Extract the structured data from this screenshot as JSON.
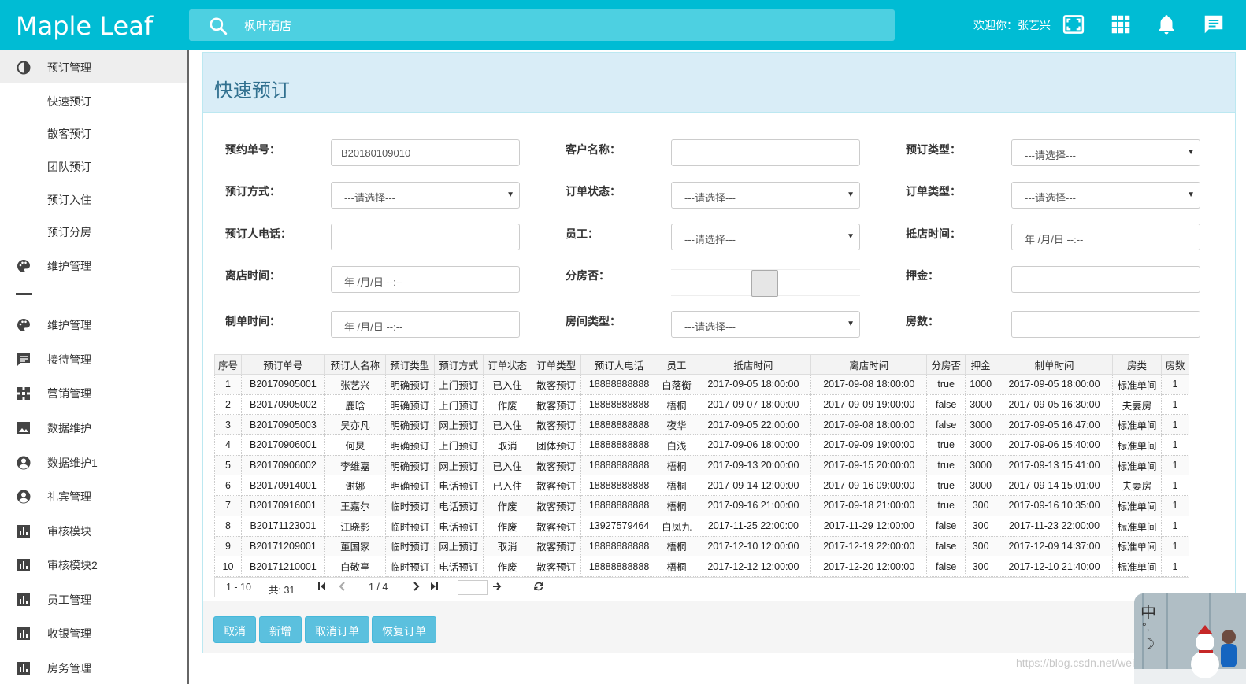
{
  "app": {
    "brand": "Maple Leaf",
    "welcome": "欢迎你：张艺兴"
  },
  "search": {
    "value": "枫叶酒店"
  },
  "icons": {
    "search": "search-icon",
    "fullscreen": "fullscreen-icon",
    "apps": "apps-grid-icon",
    "bell": "bell-icon",
    "message": "message-icon"
  },
  "colors": {
    "primary": "#00bcd4",
    "search_bg": "#4dd0e1",
    "btn": "#5bc0de",
    "panel_head": "#d9edf7",
    "title": "#31708f"
  },
  "sidebar": {
    "group1": {
      "label": "预订管理",
      "icon": "contrast-icon"
    },
    "subs": [
      "快速预订",
      "散客预订",
      "团队预订",
      "预订入住",
      "预订分房"
    ],
    "items": [
      {
        "label": "维护管理",
        "icon": "palette-icon"
      },
      {
        "label": "维护管理",
        "icon": "palette-icon"
      },
      {
        "label": "接待管理",
        "icon": "comment-icon"
      },
      {
        "label": "营销管理",
        "icon": "puzzle-icon"
      },
      {
        "label": "数据维护",
        "icon": "image-icon"
      },
      {
        "label": "数据维护1",
        "icon": "account-icon"
      },
      {
        "label": "礼宾管理",
        "icon": "account-icon"
      },
      {
        "label": "审核模块",
        "icon": "chart-bar-icon"
      },
      {
        "label": "审核模块2",
        "icon": "chart-bar-icon"
      },
      {
        "label": "员工管理",
        "icon": "chart-bar-icon"
      },
      {
        "label": "收银管理",
        "icon": "chart-bar-icon"
      },
      {
        "label": "房务管理",
        "icon": "chart-bar-icon"
      }
    ]
  },
  "panel": {
    "title": "快速预订"
  },
  "form": {
    "order_no": {
      "label": "预约单号：",
      "value": "B20180109010"
    },
    "customer": {
      "label": "客户名称：",
      "value": ""
    },
    "book_type": {
      "label": "预订类型：",
      "value": "---请选择---"
    },
    "book_way": {
      "label": "预订方式：",
      "value": "---请选择---"
    },
    "order_status": {
      "label": "订单状态：",
      "value": "---请选择---"
    },
    "order_type": {
      "label": "订单类型：",
      "value": "---请选择---"
    },
    "phone": {
      "label": "预订人电话：",
      "value": ""
    },
    "staff": {
      "label": "员工：",
      "value": "---请选择---"
    },
    "arrive": {
      "label": "抵店时间：",
      "value": "年 /月/日 --:--"
    },
    "leave": {
      "label": "离店时间：",
      "value": "年 /月/日 --:--"
    },
    "split": {
      "label": "分房否："
    },
    "deposit": {
      "label": "押金：",
      "value": ""
    },
    "made": {
      "label": "制单时间：",
      "value": "年 /月/日 --:--"
    },
    "room_type": {
      "label": "房间类型：",
      "value": "---请选择---"
    },
    "room_count": {
      "label": "房数：",
      "value": ""
    }
  },
  "table": {
    "headers": [
      "序号",
      "预订单号",
      "预订人名称",
      "预订类型",
      "预订方式",
      "订单状态",
      "订单类型",
      "预订人电话",
      "员工",
      "抵店时间",
      "离店时间",
      "分房否",
      "押金",
      "制单时间",
      "房类",
      "房数"
    ],
    "rows": [
      [
        "1",
        "B20170905001",
        "张艺兴",
        "明确预订",
        "上门预订",
        "已入住",
        "散客预订",
        "18888888888",
        "白落衡",
        "2017-09-05 18:00:00",
        "2017-09-08 18:00:00",
        "true",
        "1000",
        "2017-09-05 18:00:00",
        "标准单间",
        "1"
      ],
      [
        "2",
        "B20170905002",
        "鹿晗",
        "明确预订",
        "上门预订",
        "作废",
        "散客预订",
        "18888888888",
        "梧桐",
        "2017-09-07 18:00:00",
        "2017-09-09 19:00:00",
        "false",
        "3000",
        "2017-09-05 16:30:00",
        "夫妻房",
        "1"
      ],
      [
        "3",
        "B20170905003",
        "吴亦凡",
        "明确预订",
        "网上预订",
        "已入住",
        "散客预订",
        "18888888888",
        "夜华",
        "2017-09-05 22:00:00",
        "2017-09-08 18:00:00",
        "false",
        "3000",
        "2017-09-05 16:47:00",
        "标准单间",
        "1"
      ],
      [
        "4",
        "B20170906001",
        "何炅",
        "明确预订",
        "上门预订",
        "取消",
        "团体预订",
        "18888888888",
        "白浅",
        "2017-09-06 18:00:00",
        "2017-09-09 19:00:00",
        "true",
        "3000",
        "2017-09-06 15:40:00",
        "标准单间",
        "1"
      ],
      [
        "5",
        "B20170906002",
        "李维嘉",
        "明确预订",
        "网上预订",
        "已入住",
        "散客预订",
        "18888888888",
        "梧桐",
        "2017-09-13 20:00:00",
        "2017-09-15 20:00:00",
        "true",
        "3000",
        "2017-09-13 15:41:00",
        "标准单间",
        "1"
      ],
      [
        "6",
        "B20170914001",
        "谢娜",
        "明确预订",
        "电话预订",
        "已入住",
        "散客预订",
        "18888888888",
        "梧桐",
        "2017-09-14 12:00:00",
        "2017-09-16 09:00:00",
        "true",
        "3000",
        "2017-09-14 15:01:00",
        "夫妻房",
        "1"
      ],
      [
        "7",
        "B20170916001",
        "王嘉尔",
        "临时预订",
        "电话预订",
        "作废",
        "散客预订",
        "18888888888",
        "梧桐",
        "2017-09-16 21:00:00",
        "2017-09-18 21:00:00",
        "true",
        "300",
        "2017-09-16 10:35:00",
        "标准单间",
        "1"
      ],
      [
        "8",
        "B20171123001",
        "江晓影",
        "临时预订",
        "电话预订",
        "作废",
        "散客预订",
        "13927579464",
        "白凤九",
        "2017-11-25 22:00:00",
        "2017-11-29 12:00:00",
        "false",
        "300",
        "2017-11-23 22:00:00",
        "标准单间",
        "1"
      ],
      [
        "9",
        "B20171209001",
        "董国家",
        "临时预订",
        "网上预订",
        "取消",
        "散客预订",
        "18888888888",
        "梧桐",
        "2017-12-10 12:00:00",
        "2017-12-19 22:00:00",
        "false",
        "300",
        "2017-12-09 14:37:00",
        "标准单间",
        "1"
      ],
      [
        "10",
        "B20171210001",
        "白敬亭",
        "临时预订",
        "电话预订",
        "作废",
        "散客预订",
        "18888888888",
        "梧桐",
        "2017-12-12 12:00:00",
        "2017-12-20 12:00:00",
        "false",
        "300",
        "2017-12-10 21:40:00",
        "标准单间",
        "1"
      ]
    ]
  },
  "pager": {
    "range": "1 - 10",
    "total": "共: 31",
    "page": "1 / 4"
  },
  "buttons": {
    "cancel": "取消",
    "add": "新增",
    "cancel_order": "取消订单",
    "restore_order": "恢复订单"
  },
  "ime": {
    "char": "中",
    "punct": "°,",
    "moon": "☽"
  },
  "watermark": "https://blog.csdn.net/weixin_44646060"
}
